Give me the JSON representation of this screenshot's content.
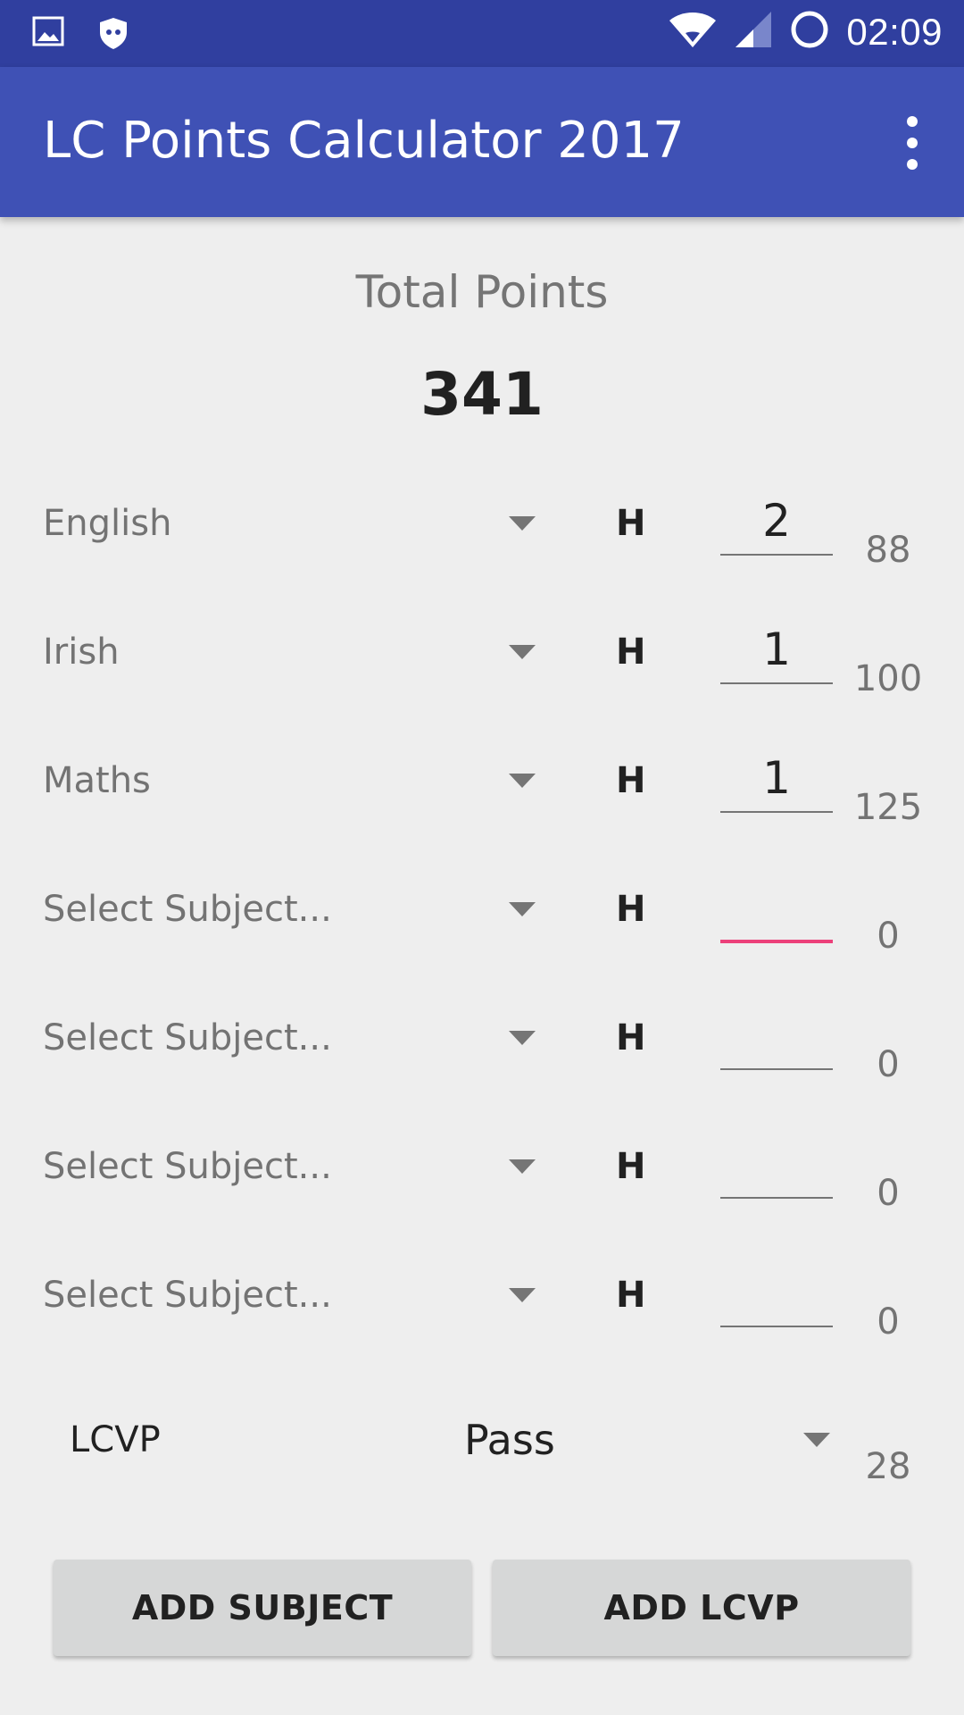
{
  "status_bar": {
    "time": "02:09",
    "icons": [
      "image-icon",
      "shield-icon",
      "wifi-icon",
      "signal-icon",
      "circle-icon"
    ]
  },
  "app_bar": {
    "title": "LC Points Calculator 2017",
    "menu_icon": "more-vert-icon"
  },
  "total": {
    "label": "Total Points",
    "value": "341"
  },
  "subjects": [
    {
      "name": "English",
      "level": "H",
      "grade": "2",
      "points": "88"
    },
    {
      "name": "Irish",
      "level": "H",
      "grade": "1",
      "points": "100"
    },
    {
      "name": "Maths",
      "level": "H",
      "grade": "1",
      "points": "125"
    },
    {
      "name": "Select Subject...",
      "level": "H",
      "grade": "",
      "points": "0"
    },
    {
      "name": "Select Subject...",
      "level": "H",
      "grade": "",
      "points": "0"
    },
    {
      "name": "Select Subject...",
      "level": "H",
      "grade": "",
      "points": "0"
    },
    {
      "name": "Select Subject...",
      "level": "H",
      "grade": "",
      "points": "0"
    }
  ],
  "lcvp": {
    "label": "LCVP",
    "value": "Pass",
    "points": "28"
  },
  "buttons": {
    "add_subject": "ADD SUBJECT",
    "add_lcvp": "ADD LCVP"
  },
  "colors": {
    "status_bar": "#303f9f",
    "app_bar": "#3f51b5",
    "focus_accent": "#ec407a"
  }
}
